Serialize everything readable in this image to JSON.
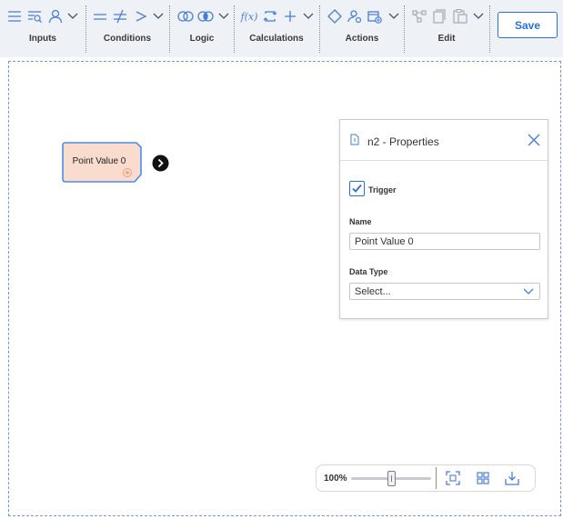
{
  "toolbar": {
    "groups": [
      {
        "label": "Inputs",
        "icons": [
          "list-icon",
          "search-list-icon",
          "user-icon",
          "chevron-down-icon"
        ]
      },
      {
        "label": "Conditions",
        "icons": [
          "equals-icon",
          "not-equals-icon",
          "greater-than-icon",
          "chevron-down-icon"
        ]
      },
      {
        "label": "Logic",
        "icons": [
          "or-circles-icon",
          "and-circles-icon",
          "chevron-down-icon"
        ]
      },
      {
        "label": "Calculations",
        "icons": [
          "function-icon",
          "loop-icon",
          "plus-icon",
          "chevron-down-icon"
        ]
      },
      {
        "label": "Actions",
        "icons": [
          "diamond-icon",
          "user-settings-icon",
          "calendar-add-icon",
          "chevron-down-icon"
        ]
      },
      {
        "label": "Edit",
        "icons": [
          "diagram-icon",
          "copy-icon",
          "paste-icon",
          "chevron-down-icon"
        ]
      }
    ],
    "save_label": "Save"
  },
  "node": {
    "label": "Point Value 0",
    "fill": "#f9dccd",
    "border": "#4a8de8"
  },
  "panel": {
    "title": "n2 - Properties",
    "trigger_label": "Trigger",
    "trigger_checked": true,
    "name_label": "Name",
    "name_value": "Point Value 0",
    "data_type_label": "Data Type",
    "data_type_value": "Select..."
  },
  "zoom": {
    "level_text": "100%",
    "level": 0.5
  },
  "colors": {
    "accent": "#2d6ee0",
    "icon": "#4a7ed6",
    "disabled": "#a6abb3"
  }
}
